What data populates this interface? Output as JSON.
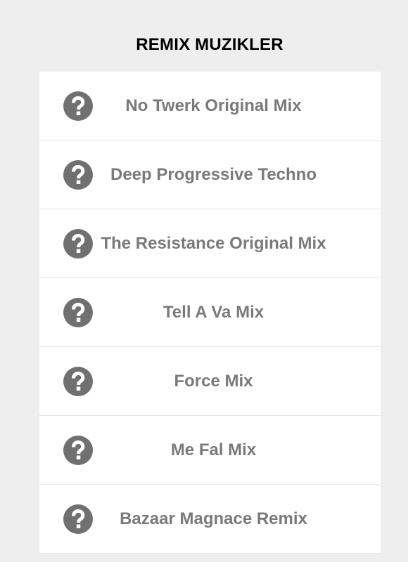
{
  "header": {
    "title": "REMIX MUZIKLER"
  },
  "list": {
    "items": [
      {
        "label": "No Twerk Original Mix",
        "icon": "question-circle-icon"
      },
      {
        "label": "Deep Progressive Techno",
        "icon": "question-circle-icon"
      },
      {
        "label": "The Resistance Original Mix",
        "icon": "question-circle-icon"
      },
      {
        "label": "Tell A Va Mix",
        "icon": "question-circle-icon"
      },
      {
        "label": "Force Mix",
        "icon": "question-circle-icon"
      },
      {
        "label": "Me Fal Mix",
        "icon": "question-circle-icon"
      },
      {
        "label": "Bazaar Magnace Remix",
        "icon": "question-circle-icon"
      }
    ]
  },
  "colors": {
    "background": "#eeeeee",
    "card": "#ffffff",
    "icon": "#707070",
    "label_text": "#7a7a7a",
    "title_text": "#000000",
    "divider": "#e6e6e6"
  }
}
